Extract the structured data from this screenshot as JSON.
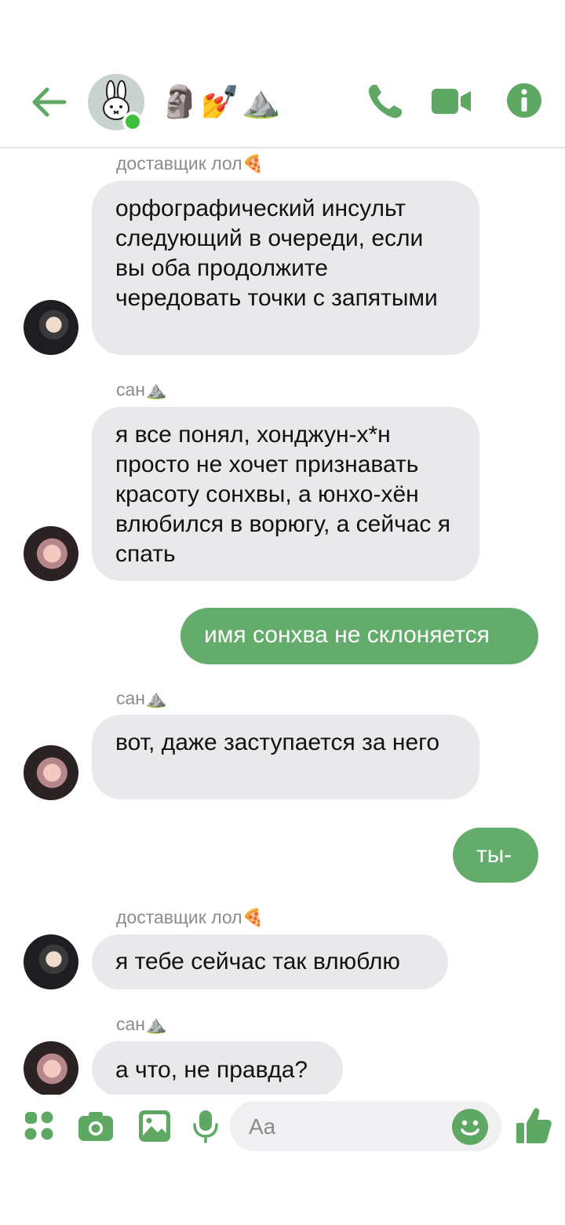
{
  "header": {
    "group_name": "🗿💅⛰️",
    "accent": "#5fa864"
  },
  "messages": [
    {
      "type": "incoming",
      "sender": "доставщик лол",
      "sender_emoji": "🍕",
      "text": "орфографический инсульт следующий в очереди, если вы оба продолжите чередовать точки с запятыми"
    },
    {
      "type": "incoming",
      "sender": "сан",
      "sender_emoji": "⛰️",
      "text": "я все понял, хонджун-х*н просто не хочет признавать красоту сонхвы, а юнхо-хён влюбился в ворюгу, а сейчас я спать"
    },
    {
      "type": "outgoing",
      "text": "имя сонхва не склоняется"
    },
    {
      "type": "incoming",
      "sender": "сан",
      "sender_emoji": "⛰️",
      "text": "вот, даже заступается за него"
    },
    {
      "type": "outgoing",
      "text": "ты-"
    },
    {
      "type": "incoming",
      "sender": "доставщик лол",
      "sender_emoji": "🍕",
      "text": "я тебе сейчас так влюблю"
    },
    {
      "type": "incoming",
      "sender": "сан",
      "sender_emoji": "⛰️",
      "text": "а что, не правда?"
    }
  ],
  "composer": {
    "placeholder": "Aa"
  },
  "colors": {
    "accent": "#5fa864",
    "outgoing_bubble": "#64ac6c",
    "incoming_bubble": "#e9e9ec"
  }
}
